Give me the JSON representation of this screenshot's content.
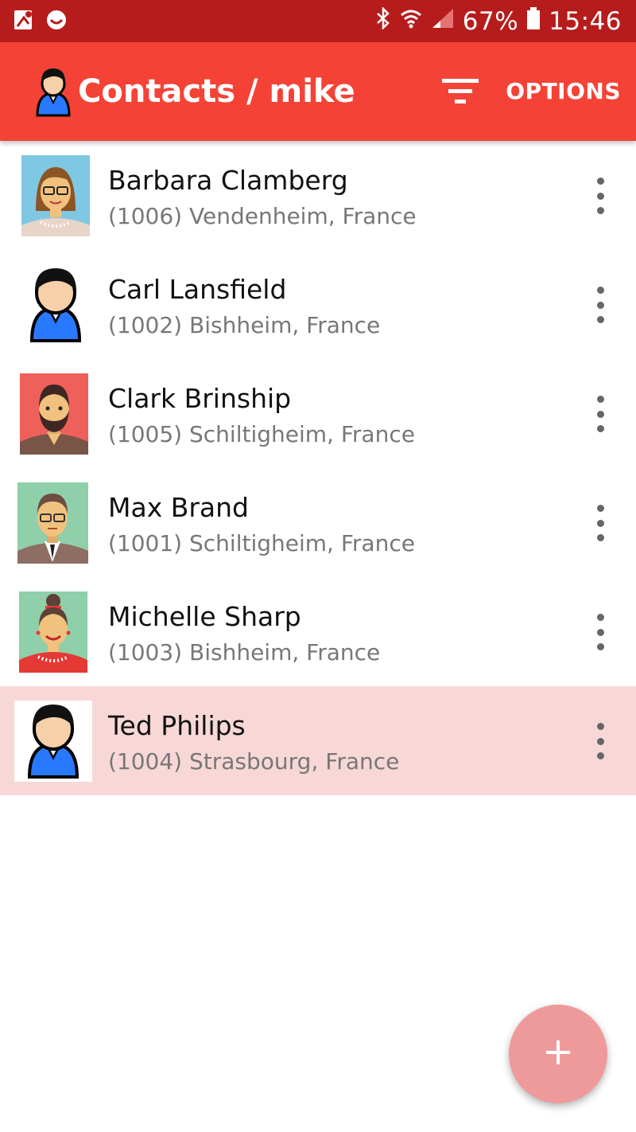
{
  "status_bar": {
    "battery_text": "67%",
    "time": "15:46",
    "icons": [
      "map-notification-icon",
      "smiley-notification-icon",
      "bluetooth-icon",
      "wifi-icon",
      "signal-icon",
      "battery-icon"
    ]
  },
  "app_bar": {
    "title": "Contacts / mike",
    "options_label": "OPTIONS",
    "background": "#f44336"
  },
  "contacts": [
    {
      "name": "Barbara Clamberg",
      "detail": "(1006) Vendenheim, France",
      "avatar": "woman-glasses-avatar"
    },
    {
      "name": "Carl Lansfield",
      "detail": "(1002) Bishheim, France",
      "avatar": "generic-person-avatar"
    },
    {
      "name": "Clark Brinship",
      "detail": "(1005) Schiltigheim, France",
      "avatar": "bearded-man-avatar"
    },
    {
      "name": "Max Brand",
      "detail": "(1001) Schiltigheim, France",
      "avatar": "man-suit-glasses-avatar"
    },
    {
      "name": "Michelle Sharp",
      "detail": "(1003) Bishheim, France",
      "avatar": "woman-bun-avatar"
    },
    {
      "name": "Ted Philips",
      "detail": "(1004) Strasbourg, France",
      "avatar": "generic-person-avatar",
      "selected": true
    }
  ],
  "fab": {
    "icon": "plus-icon",
    "color": "#ef9a9a"
  },
  "colors": {
    "status_bar": "#b71c1c",
    "selected_row": "#f8d7d7"
  }
}
